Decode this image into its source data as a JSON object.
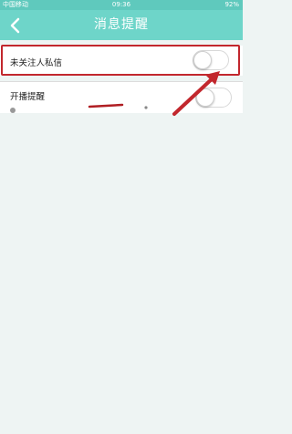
{
  "status_bar": {
    "carrier": "中国移动",
    "time": "09:36",
    "battery": "92%"
  },
  "nav": {
    "title": "消息提醒",
    "back_icon": "chevron-left-icon"
  },
  "settings": [
    {
      "label": "未关注人私信",
      "enabled": false
    },
    {
      "label": "开播提醒",
      "enabled": false
    }
  ],
  "colors": {
    "nav_bg": "#6ed5c9",
    "status_bg": "#5fc9bd",
    "highlight": "#c2272d",
    "page_bg": "#eef4f3"
  }
}
